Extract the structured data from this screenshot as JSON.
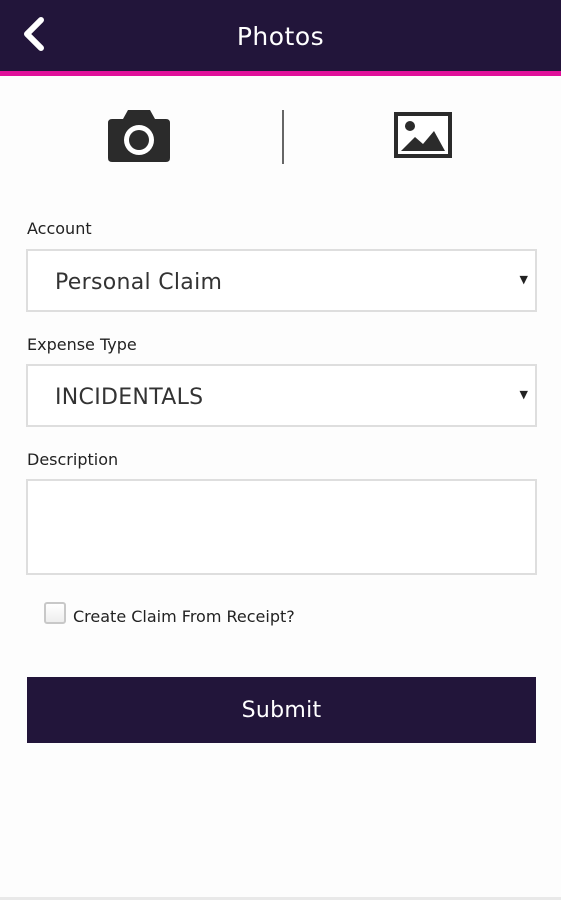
{
  "header": {
    "title": "Photos",
    "back_icon": "chevron-left-icon",
    "background_color": "#22153a",
    "accent_color": "#e0109a"
  },
  "photo_sources": {
    "camera_icon": "camera-icon",
    "gallery_icon": "image-gallery-icon"
  },
  "form": {
    "account": {
      "label": "Account",
      "value": "Personal Claim"
    },
    "expense_type": {
      "label": "Expense Type",
      "value": "INCIDENTALS"
    },
    "description": {
      "label": "Description",
      "value": ""
    },
    "create_claim": {
      "label": "Create Claim From Receipt?",
      "checked": false
    },
    "submit_label": "Submit"
  }
}
